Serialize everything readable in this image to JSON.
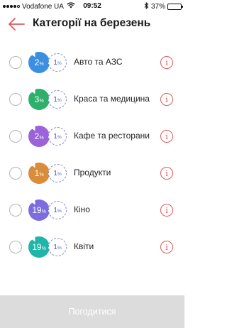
{
  "status_bar": {
    "carrier": "Vodafone UA",
    "time": "09:52",
    "battery": "37%",
    "battery_level": 0.37,
    "icons": [
      "signal-dots-icon",
      "wifi-icon",
      "bluetooth-icon",
      "battery-icon"
    ]
  },
  "header": {
    "title": "Категорії на березень",
    "back_icon": "arrow-left-icon"
  },
  "categories": [
    {
      "name": "Авто та АЗС",
      "cashback": "2",
      "extra": "1",
      "pct": "%",
      "color": "#3a8fe0"
    },
    {
      "name": "Краса та медицина",
      "cashback": "3",
      "extra": "1",
      "pct": "%",
      "color": "#2eb06b"
    },
    {
      "name": "Кафе та ресторани",
      "cashback": "2",
      "extra": "1",
      "pct": "%",
      "color": "#9b63d9"
    },
    {
      "name": "Продукти",
      "cashback": "1",
      "extra": "1",
      "pct": "%",
      "color": "#d98c3a"
    },
    {
      "name": "Кіно",
      "cashback": "19",
      "extra": "1",
      "pct": "%",
      "color": "#7d6be0"
    },
    {
      "name": "Квіти",
      "cashback": "19",
      "extra": "1",
      "pct": "%",
      "color": "#1fb5a8"
    }
  ],
  "colors": {
    "accent_red": "#e05a5a",
    "extra_badge": "#4e5fb8",
    "agree_button_disabled": "#dcdcdc"
  },
  "footer": {
    "agree_label": "Погодитися"
  }
}
